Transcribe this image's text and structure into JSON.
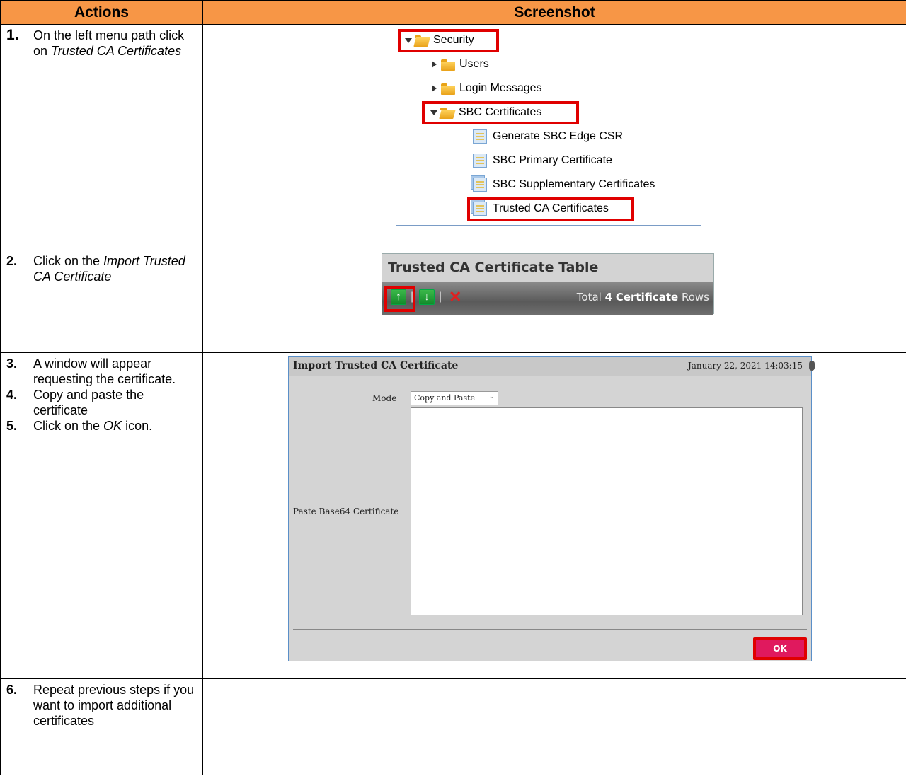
{
  "header": {
    "col_actions": "Actions",
    "col_screenshot": "Screenshot"
  },
  "rows": [
    {
      "steps": [
        {
          "num": "1.",
          "parts": [
            "On the left menu path click on ",
            "Trusted CA Certificates",
            ""
          ]
        }
      ]
    },
    {
      "steps": [
        {
          "num": "2.",
          "parts": [
            "Click on the ",
            "Import Trusted CA Certificate",
            ""
          ]
        }
      ]
    },
    {
      "steps": [
        {
          "num": "3.",
          "text": "A window will appear requesting the certificate."
        },
        {
          "num": "4.",
          "text": "Copy and paste the certificate"
        },
        {
          "num": "5.",
          "parts": [
            "Click on the ",
            "OK",
            " icon."
          ]
        }
      ]
    },
    {
      "steps": [
        {
          "num": "6.",
          "text": "Repeat previous steps if you want to import additional certificates"
        }
      ]
    }
  ],
  "tree": {
    "items": [
      "Security",
      "Users",
      "Login Messages",
      "SBC Certificates",
      "Generate SBC Edge CSR",
      "SBC Primary Certificate",
      "SBC Supplementary Certificates",
      "Trusted CA Certificates"
    ]
  },
  "cert_table": {
    "title": "Trusted CA Certificate Table",
    "total_prefix": "Total",
    "total_count": "4",
    "total_unit": "Certificate",
    "total_suffix": "Rows"
  },
  "import_dialog": {
    "title": "Import Trusted CA Certificate",
    "date": "January 22, 2021 14:03:15",
    "mode_label": "Mode",
    "mode_value": "Copy and Paste",
    "paste_label": "Paste Base64 Certificate",
    "ok_label": "OK"
  },
  "colors": {
    "header_bg": "#f79646",
    "highlight": "#e00000",
    "ok_button": "#e0195e"
  }
}
